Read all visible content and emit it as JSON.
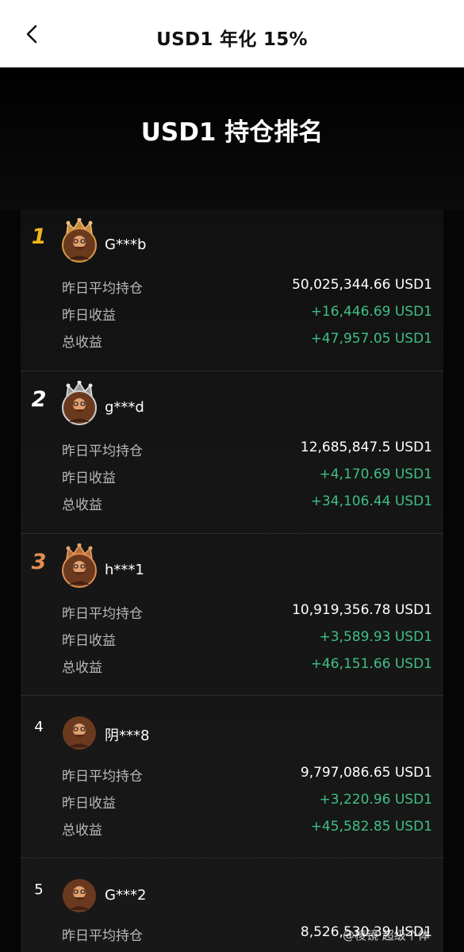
{
  "nav": {
    "title": "USD1 年化 15%"
  },
  "hero": {
    "title": "USD1 持仓排名"
  },
  "labels": {
    "avg_position": "昨日平均持仓",
    "yesterday_profit": "昨日收益",
    "total_profit": "总收益"
  },
  "entries": [
    {
      "rank": "1",
      "username": "G***b",
      "avg_position": "50,025,344.66 USD1",
      "yesterday_profit": "+16,446.69 USD1",
      "total_profit": "+47,957.05 USD1"
    },
    {
      "rank": "2",
      "username": "g***d",
      "avg_position": "12,685,847.5 USD1",
      "yesterday_profit": "+4,170.69 USD1",
      "total_profit": "+34,106.44 USD1"
    },
    {
      "rank": "3",
      "username": "h***1",
      "avg_position": "10,919,356.78 USD1",
      "yesterday_profit": "+3,589.93 USD1",
      "total_profit": "+46,151.66 USD1"
    },
    {
      "rank": "4",
      "username": "阴***8",
      "avg_position": "9,797,086.65 USD1",
      "yesterday_profit": "+3,220.96 USD1",
      "total_profit": "+45,582.85 USD1"
    },
    {
      "rank": "5",
      "username": "G***2",
      "avg_position": "8,526,530.39 USD1"
    }
  ],
  "watermark": "@棱镜·超级个体",
  "colors": {
    "gold": "#f2b51c",
    "silver": "#ffffff",
    "bronze": "#e08d52",
    "profit": "#3fbf86",
    "label": "#b8b8b8"
  },
  "icons": {
    "back": "chevron-left-icon",
    "crown": "crown-icon",
    "avatar": "avatar-photo"
  }
}
